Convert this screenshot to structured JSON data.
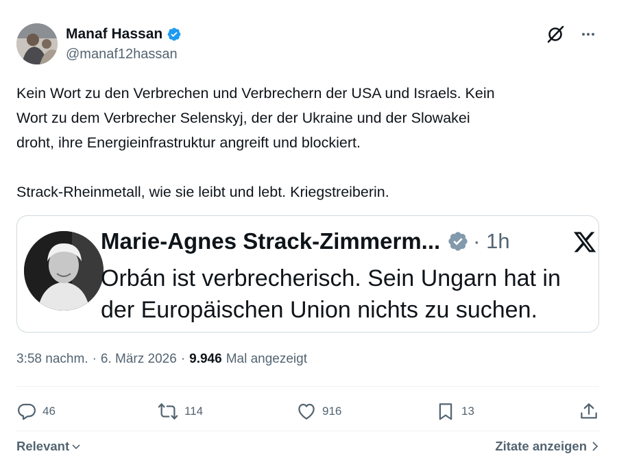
{
  "author": {
    "display_name": "Manaf Hassan",
    "handle": "@manaf12hassan",
    "verified_color": "#1d9bf0"
  },
  "header_icons": [
    "grok-icon",
    "more-icon"
  ],
  "tweet": {
    "text": "Kein Wort zu den Verbrechen und Verbrechern der USA und Israels. Kein\nWort zu dem Verbrecher Selenskyj, der der Ukraine und der Slowakei\ndroht, ihre Energieinfrastruktur angreift und blockiert.\n\nStrack-Rheinmetall, wie sie leibt und lebt. Kriegstreiberin."
  },
  "quote": {
    "name": "Marie-Agnes Strack-Zimmerm...",
    "time": "· 1h",
    "line1": "Orbán ist verbrecherisch. Sein Ungarn hat in",
    "line2": "der Europäischen Union nichts zu suchen.",
    "verified_color": "#829aab"
  },
  "meta": {
    "time": "3:58 nachm.",
    "sep1": "·",
    "date": "6. März 2026",
    "sep2": "·",
    "views": "9.946",
    "views_label": "Mal angezeigt"
  },
  "actions": {
    "replies": "46",
    "reposts": "114",
    "likes": "916",
    "bookmarks": "13"
  },
  "footer": {
    "sort_label": "Relevant",
    "quotes_label": "Zitate anzeigen"
  },
  "colors": {
    "text": "#0f1419",
    "secondary": "#536471",
    "border": "#cfd9de",
    "accent": "#1d9bf0"
  }
}
